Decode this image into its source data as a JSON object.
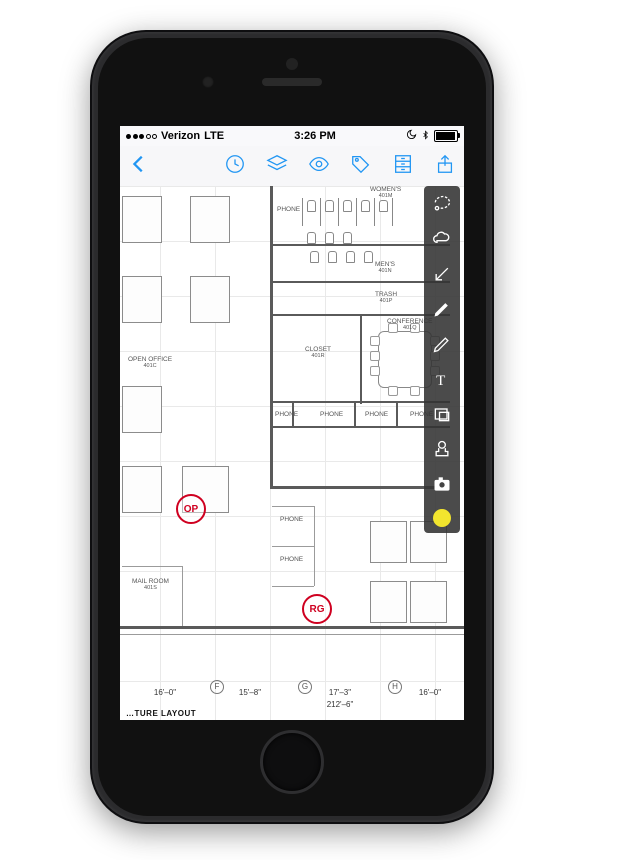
{
  "status": {
    "carrier": "Verizon",
    "network": "LTE",
    "time": "3:26 PM",
    "signal_filled": 3,
    "signal_total": 5
  },
  "nav_icons": {
    "back": "back-chevron",
    "clock": "history-icon",
    "layers": "layers-icon",
    "visibility": "eye-icon",
    "tag": "tag-icon",
    "file": "file-cabinet-icon",
    "share": "share-icon"
  },
  "tools": [
    "lasso-tool",
    "cloud-tool",
    "arrow-tool",
    "highlighter-tool",
    "pen-tool",
    "text-tool",
    "shape-tool",
    "stamp-tool",
    "camera-tool"
  ],
  "selected_color": "#f2e52e",
  "rooms": {
    "womens": {
      "label": "WOMEN'S",
      "num": "401M"
    },
    "mens": {
      "label": "MEN'S",
      "num": "401N"
    },
    "trash": {
      "label": "TRASH",
      "num": "401P"
    },
    "closet": {
      "label": "CLOSET",
      "num": "401R"
    },
    "conference": {
      "label": "CONFERENCE",
      "num": "401Q"
    },
    "open_office": {
      "label": "OPEN OFFICE",
      "num": "401C"
    },
    "mail_room": {
      "label": "MAIL ROOM",
      "num": "401S"
    },
    "phone": {
      "label": "PHONE",
      "num": ""
    }
  },
  "stamps": {
    "op": "OP",
    "rg": "RG"
  },
  "dimensions": {
    "seg1": "16'–0\"",
    "seg2": "15'–8\"",
    "seg3": "17'–3\"",
    "seg4": "16'–0\"",
    "total": "212'–6\"",
    "col_f": "F",
    "col_g": "G",
    "col_h": "H"
  },
  "drawing_title": "…TURE LAYOUT"
}
